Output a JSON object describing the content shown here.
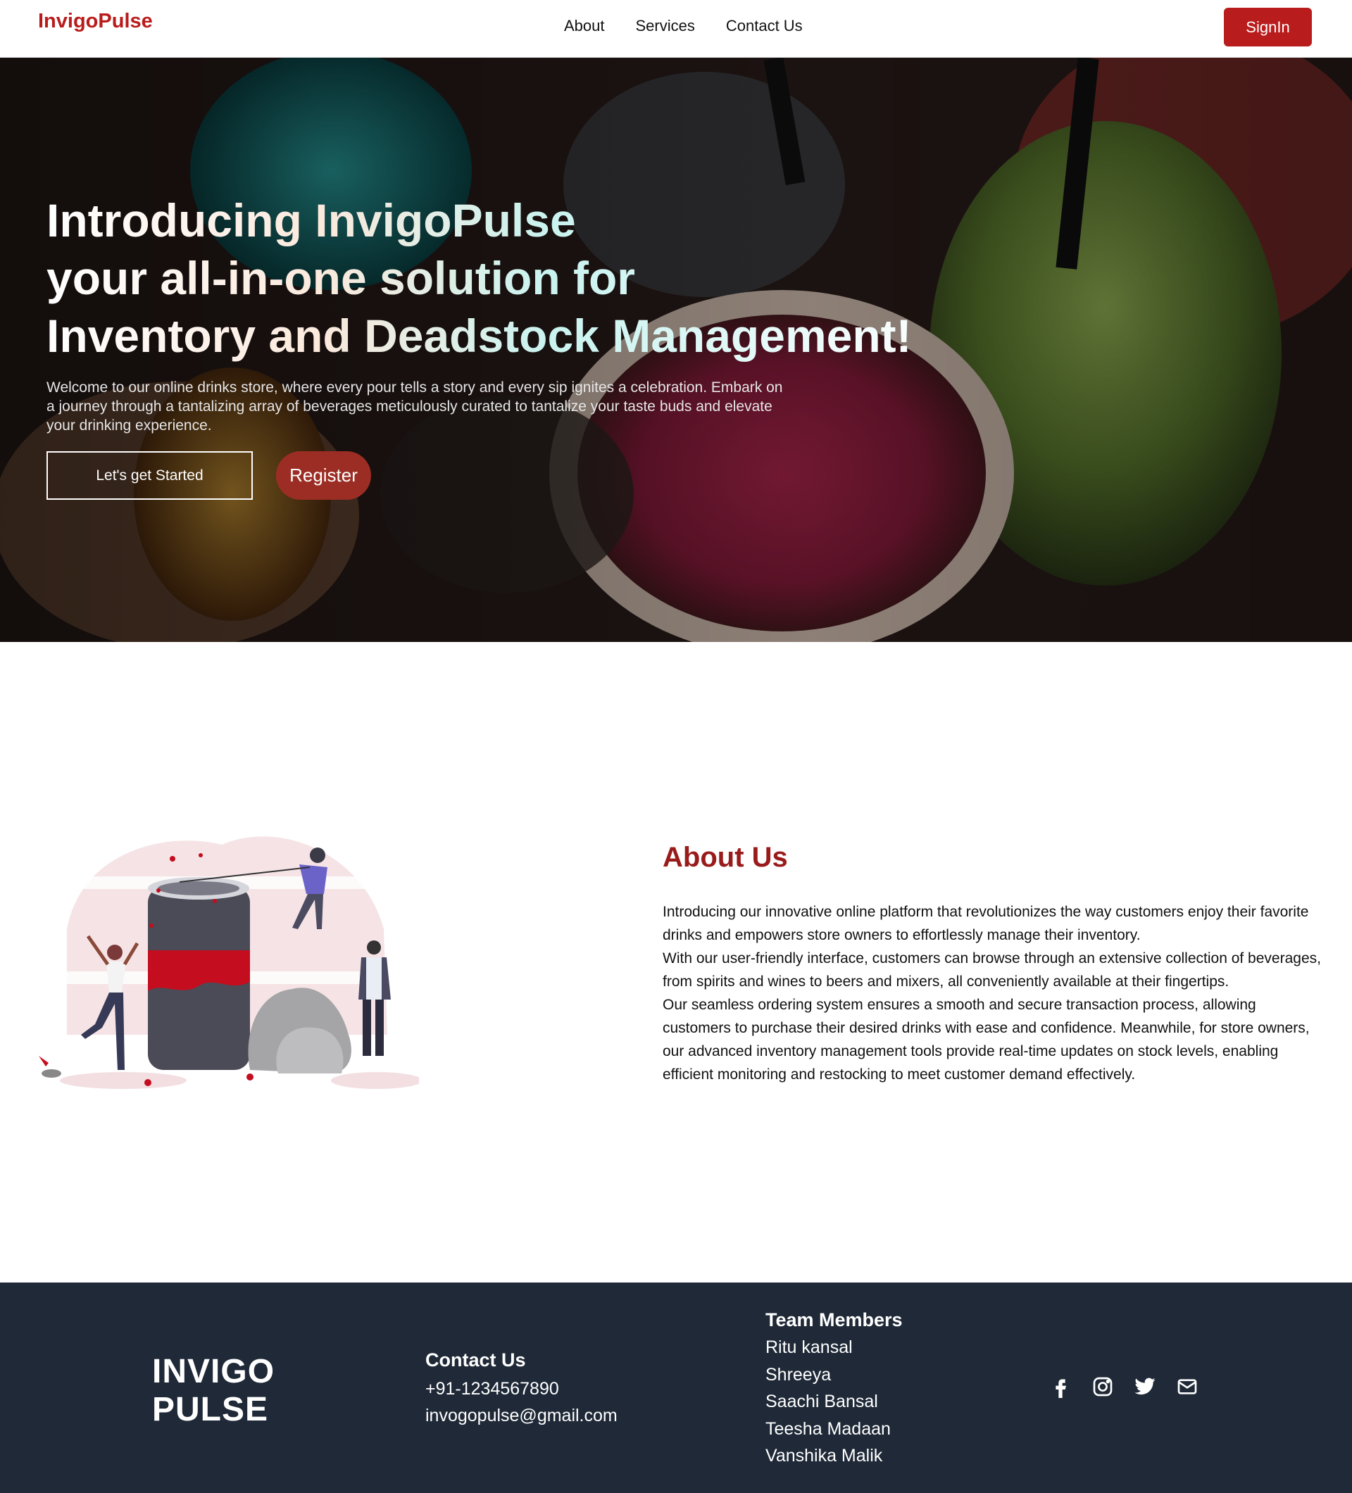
{
  "nav": {
    "brand": "InvigoPulse",
    "links": [
      "About",
      "Services",
      "Contact Us"
    ],
    "signin_label": "SignIn"
  },
  "hero": {
    "title_lines": [
      "Introducing InvigoPulse",
      "your all-in-one solution for",
      "Inventory and Deadstock Management!"
    ],
    "description": "Welcome to our online drinks store, where every pour tells a story and every sip ignites a celebration. Embark on a journey through a tantalizing array of beverages meticulously curated to tantalize your taste buds and elevate your drinking experience.",
    "start_label": "Let's get Started",
    "register_label": "Register"
  },
  "about": {
    "title": "About Us",
    "paragraphs": [
      "Introducing our innovative online platform that revolutionizes the way customers enjoy their favorite drinks and empowers store owners to effortlessly manage their inventory.",
      "With our user-friendly interface, customers can browse through an extensive collection of beverages, from spirits and wines to beers and mixers, all conveniently available at their fingertips.",
      "Our seamless ordering system ensures a smooth and secure transaction process, allowing customers to purchase their desired drinks with ease and confidence. Meanwhile, for store owners, our advanced inventory management tools provide real-time updates on stock levels, enabling efficient monitoring and restocking to meet customer demand effectively."
    ]
  },
  "footer": {
    "brand_line1": "INVIGO",
    "brand_line2": "PULSE",
    "contact_title": "Contact Us",
    "phone": "+91-1234567890",
    "email": "invogopulse@gmail.com",
    "team_title": "Team Members",
    "team": [
      "Ritu kansal",
      "Shreeya",
      "Saachi Bansal",
      "Teesha Madaan",
      "Vanshika Malik"
    ],
    "social_icons": [
      "facebook-icon",
      "instagram-icon",
      "twitter-icon",
      "mail-icon"
    ]
  },
  "colors": {
    "brand_red": "#b91c1c",
    "about_title": "#991b1b",
    "register_button": "#9b2d24",
    "footer_bg": "#1f2937"
  }
}
